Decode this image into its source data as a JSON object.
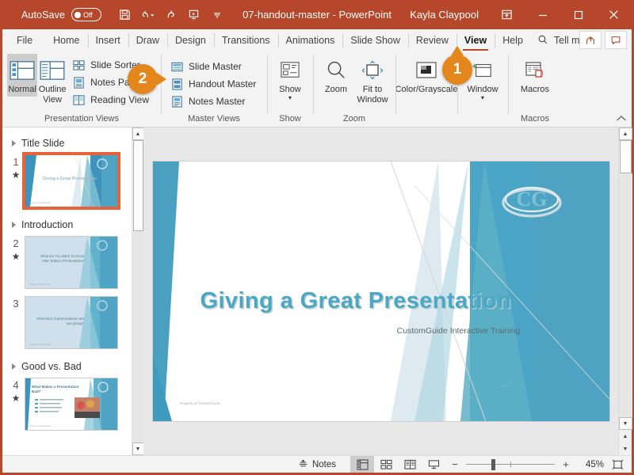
{
  "titlebar": {
    "autosave_label": "AutoSave",
    "autosave_state": "Off",
    "document_title": "07-handout-master  -  PowerPoint",
    "user_name": "Kayla Claypool",
    "quick_access": [
      {
        "name": "save-icon",
        "tooltip": "Save"
      },
      {
        "name": "undo-icon",
        "tooltip": "Undo"
      },
      {
        "name": "redo-icon",
        "tooltip": "Redo"
      },
      {
        "name": "start-slideshow-icon",
        "tooltip": "Start From Beginning"
      },
      {
        "name": "customize-qat-icon",
        "tooltip": "Customize Quick Access Toolbar"
      }
    ],
    "window_controls": [
      {
        "name": "ribbon-display-options-icon"
      },
      {
        "name": "minimize-icon"
      },
      {
        "name": "maximize-icon"
      },
      {
        "name": "close-icon"
      }
    ],
    "bar_color": "#b7472a"
  },
  "tabs": [
    {
      "label": "File"
    },
    {
      "label": "Home"
    },
    {
      "label": "Insert"
    },
    {
      "label": "Draw"
    },
    {
      "label": "Design"
    },
    {
      "label": "Transitions"
    },
    {
      "label": "Animations"
    },
    {
      "label": "Slide Show"
    },
    {
      "label": "Review"
    },
    {
      "label": "View"
    },
    {
      "label": "Help"
    }
  ],
  "active_tab": "View",
  "tellme": {
    "label": "Tell me",
    "icon": "search-icon"
  },
  "tab_right_buttons": [
    {
      "name": "share-icon"
    },
    {
      "name": "comments-icon"
    }
  ],
  "ribbon": {
    "groups": [
      {
        "title": "Presentation Views",
        "big_buttons": [
          {
            "label": "Normal",
            "icon": "normal-view-icon",
            "selected": true
          },
          {
            "label": "Outline View",
            "icon": "outline-view-icon",
            "selected": false
          }
        ],
        "small_buttons": [
          {
            "label": "Slide Sorter",
            "icon": "slide-sorter-icon"
          },
          {
            "label": "Notes Page",
            "icon": "notes-page-icon"
          },
          {
            "label": "Reading View",
            "icon": "reading-view-icon"
          }
        ]
      },
      {
        "title": "Master Views",
        "small_buttons": [
          {
            "label": "Slide Master",
            "icon": "slide-master-icon"
          },
          {
            "label": "Handout Master",
            "icon": "handout-master-icon"
          },
          {
            "label": "Notes Master",
            "icon": "notes-master-icon"
          }
        ]
      },
      {
        "title": "Show",
        "big_buttons": [
          {
            "label": "Show",
            "icon": "show-icon",
            "has_caret": true
          }
        ]
      },
      {
        "title": "Zoom",
        "big_buttons": [
          {
            "label": "Zoom",
            "icon": "zoom-magnifier-icon"
          },
          {
            "label": "Fit to Window",
            "icon": "fit-to-window-icon"
          }
        ]
      },
      {
        "title": "",
        "big_buttons": [
          {
            "label": "Color/Grayscale",
            "icon": "color-grayscale-icon",
            "has_caret": true
          }
        ]
      },
      {
        "title": "",
        "big_buttons": [
          {
            "label": "Window",
            "icon": "window-icon",
            "has_caret": true
          }
        ]
      },
      {
        "title": "Macros",
        "big_buttons": [
          {
            "label": "Macros",
            "icon": "macros-icon"
          }
        ]
      }
    ],
    "collapse_icon": "chevron-up-icon"
  },
  "callouts": [
    {
      "number": "1",
      "points": "up",
      "target": "View tab"
    },
    {
      "number": "2",
      "points": "left",
      "target": "Handout Master"
    }
  ],
  "callout_color": "#e3861b",
  "thumbnails": {
    "sections": [
      {
        "title": "Title Slide",
        "slides": [
          {
            "number": "1",
            "animated": true,
            "selected": true,
            "text": "Giving a Great Presentation",
            "footer": "Property of CustomGuide"
          }
        ]
      },
      {
        "title": "Introduction",
        "slides": [
          {
            "number": "2",
            "animated": true,
            "selected": false,
            "text": "What Do You Want To Know After Today's Presentation?",
            "footer": "Property of CustomGuide"
          },
          {
            "number": "3",
            "animated": false,
            "selected": false,
            "text": "What kind of presentations are you giving?",
            "footer": "Property of CustomGuide"
          }
        ]
      },
      {
        "title": "Good vs. Bad",
        "slides": [
          {
            "number": "4",
            "animated": true,
            "selected": false,
            "text": "What Makes a Presentation Bad?",
            "footer": "Property of CustomGuide"
          }
        ]
      }
    ]
  },
  "slide": {
    "title": "Giving a Great Presentation",
    "subtitle": "CustomGuide Interactive Training",
    "footer": "Property of CustomGuide",
    "date": "4/9/19",
    "accent_color": "#4aa8c4"
  },
  "statusbar": {
    "notes_label": "Notes",
    "notes_icon": "notes-icon",
    "view_buttons": [
      {
        "name": "normal-view-button",
        "icon": "normal-view-icon",
        "selected": true
      },
      {
        "name": "slide-sorter-button",
        "icon": "slide-sorter-icon",
        "selected": false
      },
      {
        "name": "reading-view-button",
        "icon": "reading-view-icon",
        "selected": false
      },
      {
        "name": "slideshow-button",
        "icon": "slideshow-icon",
        "selected": false
      }
    ],
    "zoom_out": "−",
    "zoom_in": "+",
    "zoom_percent": "45%",
    "fit_slide_icon": "fit-slide-icon"
  }
}
